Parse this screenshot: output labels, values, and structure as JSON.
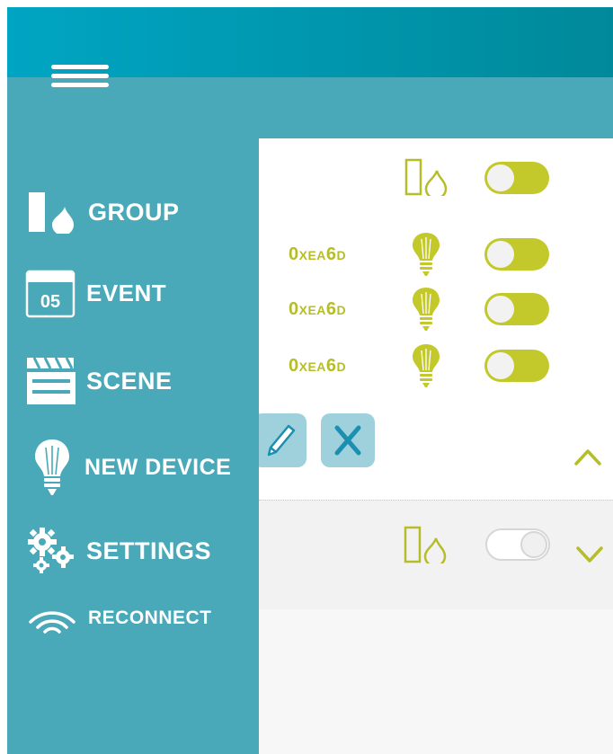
{
  "header": {
    "menu_icon": "hamburger-icon"
  },
  "sidebar": {
    "items": [
      {
        "label": "GROUP",
        "icon": "group-icon"
      },
      {
        "label": "EVENT",
        "icon": "calendar-icon",
        "calendar_day": "05"
      },
      {
        "label": "SCENE",
        "icon": "clapperboard-icon"
      },
      {
        "label": "NEW DEVICE",
        "icon": "bulb-icon"
      },
      {
        "label": "SETTINGS",
        "icon": "gears-icon"
      },
      {
        "label": "RECONNECT",
        "icon": "wifi-icon"
      }
    ]
  },
  "groups": [
    {
      "expanded": true,
      "icon": "group-icon",
      "toggle_on": true,
      "devices": [
        {
          "id_prefix": "0",
          "id_x": "XEA",
          "id_6": "6",
          "id_d": "D",
          "icon": "bulb-icon",
          "toggle_on": true
        },
        {
          "id_prefix": "0",
          "id_x": "XEA",
          "id_6": "6",
          "id_d": "D",
          "icon": "bulb-icon",
          "toggle_on": true
        },
        {
          "id_prefix": "0",
          "id_x": "XEA",
          "id_6": "6",
          "id_d": "D",
          "icon": "bulb-icon",
          "toggle_on": true
        }
      ],
      "actions": [
        "edit-icon",
        "delete-icon"
      ],
      "chevron": "chevron-up-icon"
    },
    {
      "expanded": false,
      "icon": "group-icon",
      "toggle_on": false,
      "chevron": "chevron-down-icon"
    }
  ],
  "colors": {
    "accent": "#c3c92a",
    "sidebar": "#4aa9b9",
    "topbar_start": "#00a5c3",
    "topbar_end": "#00899a"
  }
}
